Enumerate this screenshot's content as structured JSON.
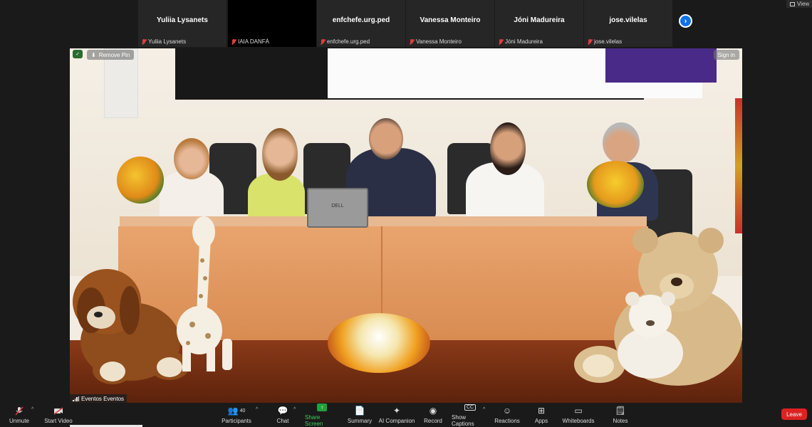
{
  "top_strip": {
    "tiles": [
      {
        "display": "Yuliia Lysanets",
        "tag": "Yuliia Lysanets"
      },
      {
        "display": "",
        "tag": "IAIA DANFÁ"
      },
      {
        "display": "enfchefe.urg.ped",
        "tag": "enfchefe.urg.ped"
      },
      {
        "display": "Vanessa Monteiro",
        "tag": "Vanessa Monteiro"
      },
      {
        "display": "Jóni Madureira",
        "tag": "Jóni Madureira"
      },
      {
        "display": "jose.vilelas",
        "tag": "jose.vilelas"
      }
    ],
    "next_icon": "›",
    "view_label": "View"
  },
  "main_video": {
    "remove_pin_label": "Remove Pin",
    "sign_in_label": "Sign in",
    "speaker_name": "Eventos Eventos",
    "laptop_brand": "DELL"
  },
  "toolbar": {
    "unmute": {
      "label": "Unmute",
      "icon": "mic-muted-icon"
    },
    "start_video": {
      "label": "Start Video",
      "icon": "video-off-icon"
    },
    "participants": {
      "label": "Participants",
      "count": "40"
    },
    "chat": {
      "label": "Chat"
    },
    "share_screen": {
      "label": "Share Screen"
    },
    "summary": {
      "label": "Summary"
    },
    "ai_companion": {
      "label": "AI Companion"
    },
    "record": {
      "label": "Record"
    },
    "show_captions": {
      "label": "Show Captions",
      "icon_text": "CC"
    },
    "reactions": {
      "label": "Reactions"
    },
    "apps": {
      "label": "Apps"
    },
    "whiteboards": {
      "label": "Whiteboards"
    },
    "notes": {
      "label": "Notes"
    },
    "leave": {
      "label": "Leave"
    }
  },
  "colors": {
    "accent": "#0e71eb",
    "leave": "#dd2222",
    "share": "#23a03c",
    "muted": "#e03e3e"
  }
}
